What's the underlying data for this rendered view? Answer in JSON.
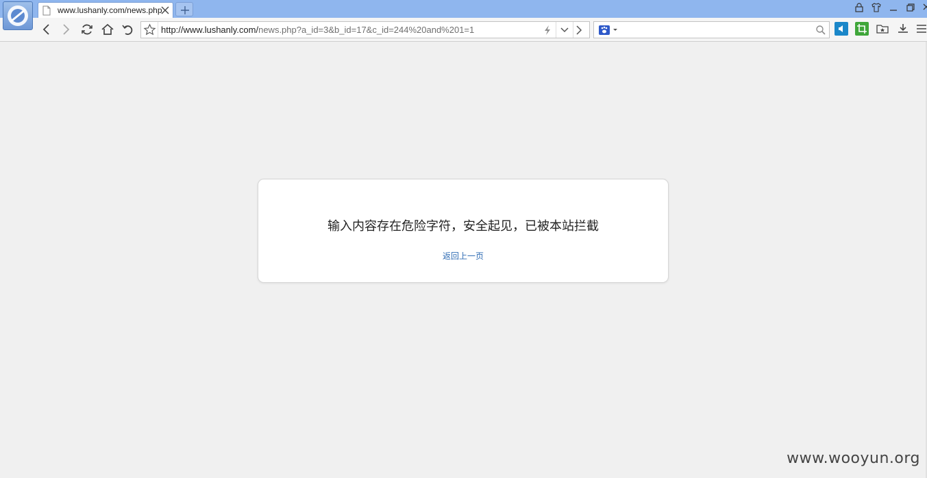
{
  "browser": {
    "tab": {
      "title": "www.lushanly.com/news.php"
    },
    "address": {
      "host": "http://www.lushanly.com/",
      "path": "news.php?a_id=3&b_id=17&c_id=244%20and%201=1"
    },
    "search": {
      "placeholder": "",
      "engine_color": "#2e59c9"
    },
    "accent": "#8fb6ee"
  },
  "page": {
    "message": "输入内容存在危险字符，安全起见，已被本站拦截",
    "back_link": "返回上一页"
  },
  "watermark": "www.wooyun.org"
}
